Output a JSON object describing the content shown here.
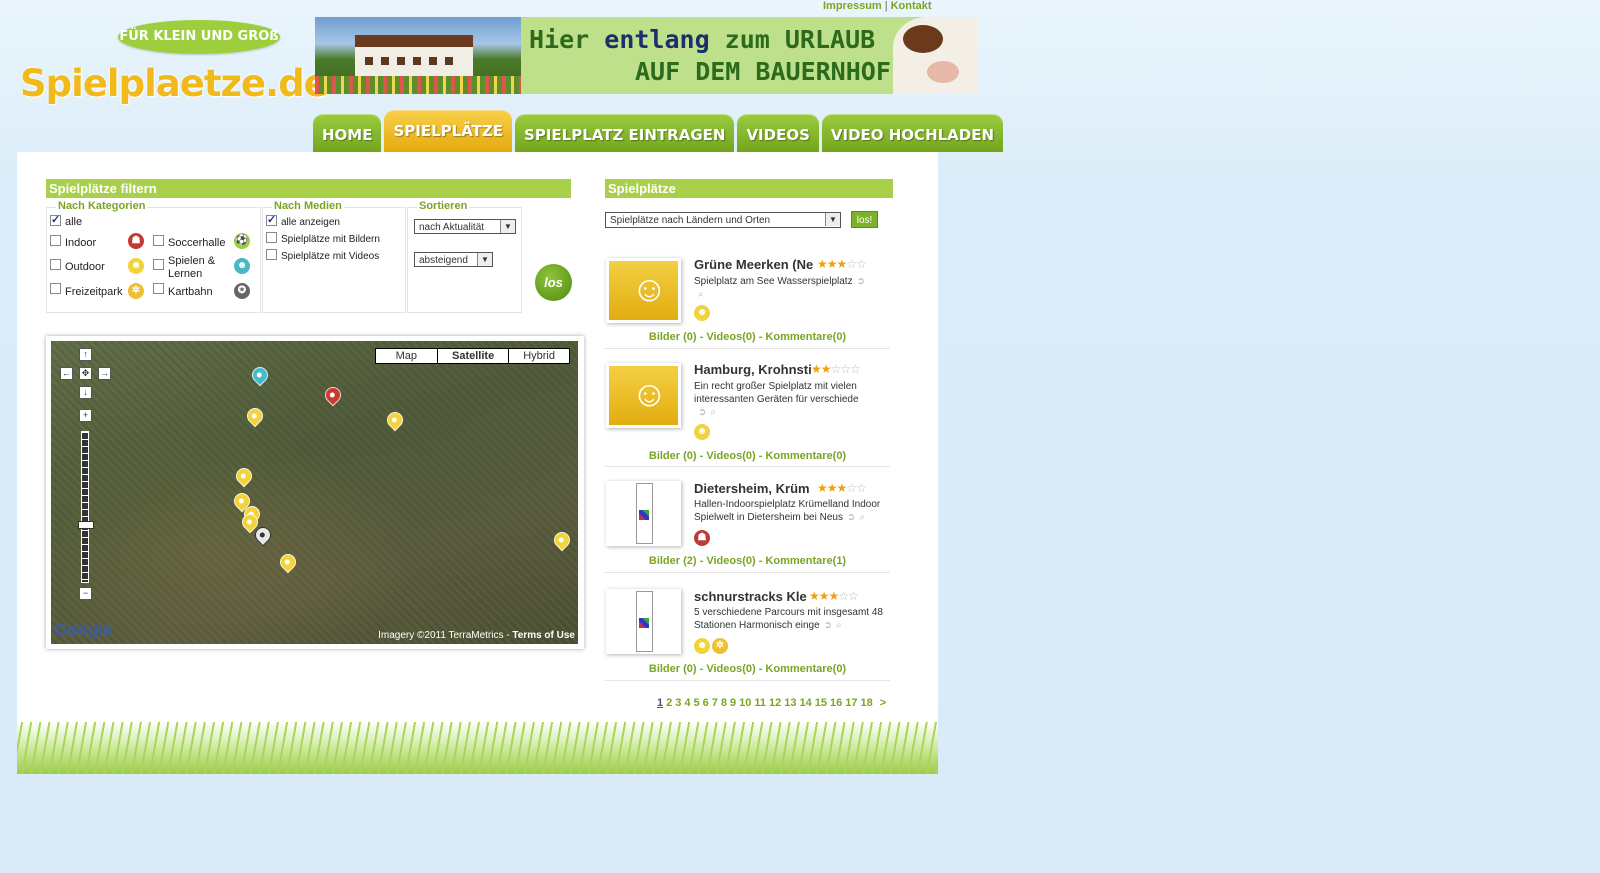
{
  "toplinks": {
    "impressum": "Impressum",
    "separator": "|",
    "kontakt": "Kontakt"
  },
  "logo": {
    "tagline": "FÜR KLEIN UND GROß",
    "name": "Spielplaetze.de"
  },
  "banner": {
    "line1_a": "Hier ",
    "line1_b": "entlang",
    "line1_c": " zum URLAUB",
    "line2": "AUF DEM BAUERNHOF"
  },
  "nav": [
    {
      "label": "HOME",
      "active": false
    },
    {
      "label": "SPIELPLÄTZE",
      "active": true
    },
    {
      "label": "SPIELPLATZ EINTRAGEN",
      "active": false
    },
    {
      "label": "VIDEOS",
      "active": false
    },
    {
      "label": "VIDEO HOCHLADEN",
      "active": false
    }
  ],
  "filter": {
    "title": "Spielplätze filtern",
    "kategorien": {
      "title": "Nach Kategorien",
      "all": {
        "label": "alle",
        "checked": true
      },
      "items": [
        {
          "label": "Indoor",
          "icon": "indoor-icon",
          "color": "#c23a35",
          "checked": false
        },
        {
          "label": "Soccerhalle",
          "icon": "soccer-icon",
          "color": "#9ccd3b",
          "checked": false
        },
        {
          "label": "Outdoor",
          "icon": "outdoor-icon",
          "color": "#f0d43c",
          "checked": false
        },
        {
          "label": "Spielen & Lernen",
          "icon": "learning-icon",
          "color": "#49b7c6",
          "checked": false
        },
        {
          "label": "Freizeitpark",
          "icon": "ferris-wheel-icon",
          "color": "#efbf2e",
          "checked": false
        },
        {
          "label": "Kartbahn",
          "icon": "kart-icon",
          "color": "#666666",
          "checked": false
        }
      ]
    },
    "medien": {
      "title": "Nach Medien",
      "items": [
        {
          "label": "alle anzeigen",
          "checked": true
        },
        {
          "label": "Spielplätze mit Bildern",
          "checked": false
        },
        {
          "label": "Spielplätze mit Videos",
          "checked": false
        }
      ]
    },
    "sortieren": {
      "title": "Sortieren",
      "sort_by": "nach Aktualität",
      "order": "absteigend"
    },
    "go_label": "los"
  },
  "map": {
    "types": [
      "Map",
      "Satellite",
      "Hybrid"
    ],
    "active_type": "Satellite",
    "logo": "Google",
    "imagery": "Imagery ©2011 TerraMetrics - ",
    "terms": "Terms of Use"
  },
  "list": {
    "title": "Spielplätze",
    "select": "Spielplätze nach Ländern und Orten",
    "go_label": "los!",
    "entries": [
      {
        "title": "Grüne Meerken (Ne",
        "rating": 3,
        "desc": "Spielplatz am See Wasserspielplatz",
        "thumb": "yellow",
        "icons": [
          "outdoor-icon"
        ],
        "links": "Bilder (0) - Videos(0) - Kommentare(0)"
      },
      {
        "title": "Hamburg, Krohnsti",
        "rating": 2,
        "desc": "Ein recht großer Spielplatz mit vielen interessanten Geräten für verschiede",
        "thumb": "yellow",
        "icons": [
          "outdoor-icon"
        ],
        "links": "Bilder (0) - Videos(0) - Kommentare(0)"
      },
      {
        "title": "Dietersheim, Krüm",
        "rating": 3,
        "desc": "Hallen-Indoorspielplatz Krümelland Indoor Spielwelt in Dietersheim bei Neus",
        "thumb": "broken",
        "icons": [
          "indoor-icon"
        ],
        "links": "Bilder (2) - Videos(0) - Kommentare(1)"
      },
      {
        "title": "schnurstracks Kle",
        "rating": 3,
        "desc": "5 verschiedene Parcours mit insgesamt 48 Stationen Harmonisch einge",
        "thumb": "broken",
        "icons": [
          "outdoor-icon",
          "ferris-wheel-icon"
        ],
        "links": "Bilder (0) - Videos(0) - Kommentare(0)"
      }
    ],
    "pager": {
      "pages": [
        "1",
        "2",
        "3",
        "4",
        "5",
        "6",
        "7",
        "8",
        "9",
        "10",
        "11",
        "12",
        "13",
        "14",
        "15",
        "16",
        "17",
        "18"
      ],
      "current": "1",
      "next": ">"
    }
  }
}
